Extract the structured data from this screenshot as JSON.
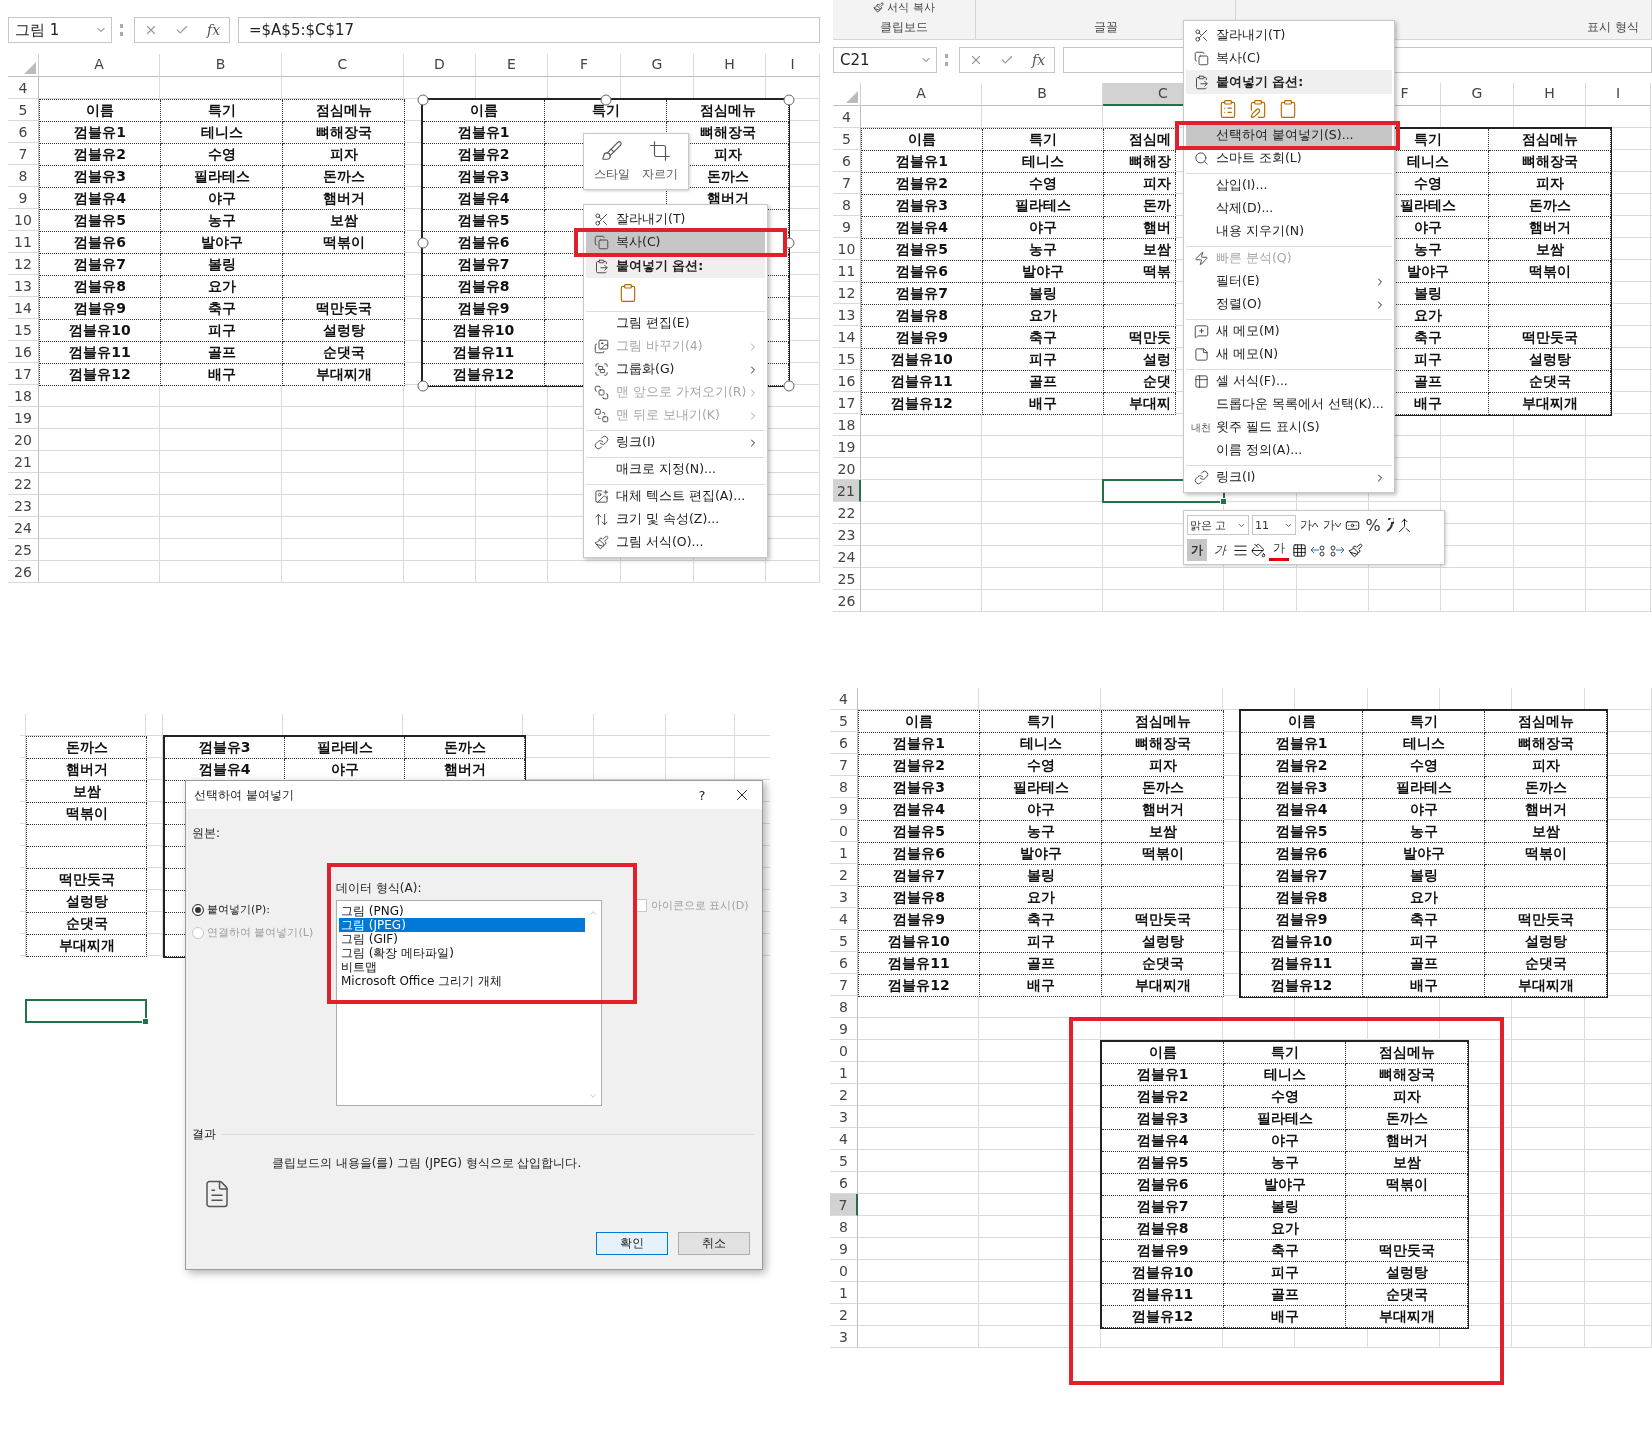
{
  "copy_step": {
    "name_box": "그림 1",
    "fx": "fx",
    "formula": "=$A$5:$C$17",
    "columns": [
      {
        "label": "A",
        "selected": false
      },
      {
        "label": "B",
        "selected": false
      },
      {
        "label": "C",
        "selected": false
      },
      {
        "label": "D",
        "selected": false
      },
      {
        "label": "E",
        "selected": false
      },
      {
        "label": "F",
        "selected": false
      },
      {
        "label": "G",
        "selected": false
      },
      {
        "label": "H",
        "selected": false
      },
      {
        "label": "I",
        "selected": false
      }
    ],
    "rows": [
      {
        "label": "4",
        "selected": false
      },
      {
        "label": "5",
        "selected": false
      },
      {
        "label": "6",
        "selected": false
      },
      {
        "label": "7",
        "selected": false
      },
      {
        "label": "8",
        "selected": false
      },
      {
        "label": "9",
        "selected": false
      },
      {
        "label": "10",
        "selected": false
      },
      {
        "label": "11",
        "selected": false
      },
      {
        "label": "12",
        "selected": false
      },
      {
        "label": "13",
        "selected": false
      },
      {
        "label": "14",
        "selected": false
      },
      {
        "label": "15",
        "selected": false
      },
      {
        "label": "16",
        "selected": false
      },
      {
        "label": "17",
        "selected": false
      },
      {
        "label": "18",
        "selected": false
      },
      {
        "label": "19",
        "selected": false
      },
      {
        "label": "20",
        "selected": false
      },
      {
        "label": "21",
        "selected": false
      },
      {
        "label": "22",
        "selected": false
      },
      {
        "label": "23",
        "selected": false
      },
      {
        "label": "24",
        "selected": false
      },
      {
        "label": "25",
        "selected": false
      },
      {
        "label": "26",
        "selected": false
      }
    ],
    "table": [
      {
        "col_1": "이름",
        "col_2": "특기",
        "col_3": "점심메뉴"
      },
      {
        "col_1": "껌블유1",
        "col_2": "테니스",
        "col_3": "뼈해장국"
      },
      {
        "col_1": "껌블유2",
        "col_2": "수영",
        "col_3": "피자"
      },
      {
        "col_1": "껌블유3",
        "col_2": "필라테스",
        "col_3": "돈까스"
      },
      {
        "col_1": "껌블유4",
        "col_2": "야구",
        "col_3": "햄버거"
      },
      {
        "col_1": "껌블유5",
        "col_2": "농구",
        "col_3": "보쌈"
      },
      {
        "col_1": "껌블유6",
        "col_2": "발야구",
        "col_3": "떡볶이"
      },
      {
        "col_1": "껌블유7",
        "col_2": "볼링"
      },
      {
        "col_1": "껌블유8",
        "col_2": "요가"
      },
      {
        "col_1": "껌블유9",
        "col_2": "축구",
        "col_3": "떡만둣국"
      },
      {
        "col_1": "껌블유10",
        "col_2": "피구",
        "col_3": "설렁탕"
      },
      {
        "col_1": "껌블유11",
        "col_2": "골프",
        "col_3": "순댓국"
      },
      {
        "col_1": "껌블유12",
        "col_2": "배구",
        "col_3": "부대찌개"
      }
    ],
    "picture_table": {
      "selected": true,
      "rows": [
        {
          "col_1": "이름",
          "col_2": "특기",
          "col_3": "점심메뉴"
        },
        {
          "col_1": "껌블유1",
          "col_3": "뼈해장국"
        },
        {
          "col_1": "껌블유2",
          "col_3": "피자"
        },
        {
          "col_1": "껌블유3",
          "col_3": "돈까스"
        },
        {
          "col_1": "껌블유4",
          "col_3": "햄버거"
        },
        {
          "col_1": "껌블유5"
        },
        {
          "col_1": "껌블유6"
        },
        {
          "col_1": "껌블유7"
        },
        {
          "col_1": "껌블유8"
        },
        {
          "col_1": "껌블유9"
        },
        {
          "col_1": "껌블유10"
        },
        {
          "col_1": "껌블유11"
        },
        {
          "col_1": "껌블유12"
        }
      ]
    },
    "mini_toolbar": [
      {
        "label": "스타일"
      },
      {
        "label": "자르기"
      }
    ],
    "menu": [
      {
        "kind": "item",
        "label": "잘라내기(T)",
        "highlighted": false,
        "disabled": false,
        "submenu": false,
        "separator_before": false
      },
      {
        "kind": "item",
        "label": "복사(C)",
        "highlighted": true,
        "disabled": false,
        "submenu": false,
        "separator_before": false
      },
      {
        "kind": "header",
        "label": "붙여넣기 옵션:",
        "highlighted": false,
        "disabled": false,
        "submenu": false,
        "separator_before": false
      },
      {
        "kind": "paste_icons",
        "highlighted": false,
        "disabled": false,
        "submenu": false,
        "separator_before": false
      },
      {
        "kind": "item",
        "label": "그림 편집(E)",
        "highlighted": false,
        "disabled": false,
        "submenu": false,
        "separator_before": true
      },
      {
        "kind": "item",
        "label": "그림 바꾸기(4)",
        "highlighted": false,
        "disabled": true,
        "submenu": true,
        "separator_before": false
      },
      {
        "kind": "item",
        "label": "그룹화(G)",
        "highlighted": false,
        "disabled": false,
        "submenu": true,
        "separator_before": false
      },
      {
        "kind": "item",
        "label": "맨 앞으로 가져오기(R)",
        "highlighted": false,
        "disabled": true,
        "submenu": true,
        "separator_before": false
      },
      {
        "kind": "item",
        "label": "맨 뒤로 보내기(K)",
        "highlighted": false,
        "disabled": true,
        "submenu": true,
        "separator_before": false
      },
      {
        "kind": "item",
        "label": "링크(I)",
        "highlighted": false,
        "disabled": false,
        "submenu": true,
        "separator_before": true
      },
      {
        "kind": "item",
        "label": "매크로 지정(N)...",
        "highlighted": false,
        "disabled": false,
        "submenu": false,
        "separator_before": true
      },
      {
        "kind": "item",
        "label": "대체 텍스트 편집(A)...",
        "highlighted": false,
        "disabled": false,
        "submenu": false,
        "separator_before": true
      },
      {
        "kind": "item",
        "label": "크기 및 속성(Z)...",
        "highlighted": false,
        "disabled": false,
        "submenu": false,
        "separator_before": false
      },
      {
        "kind": "item",
        "label": "그림 서식(O)...",
        "highlighted": false,
        "disabled": false,
        "submenu": false,
        "separator_before": false
      }
    ]
  },
  "paste_menu_step": {
    "ribbon": {
      "top_item": "서식 복사",
      "groups": [
        "클립보드",
        "글꼴",
        "표시 형식"
      ]
    },
    "name_box": "C21",
    "fx": "fx",
    "columns": [
      {
        "label": "A",
        "selected": false
      },
      {
        "label": "B",
        "selected": false
      },
      {
        "label": "C",
        "selected": true
      },
      {
        "label": "F",
        "selected": false
      },
      {
        "label": "G",
        "selected": false
      },
      {
        "label": "H",
        "selected": false
      },
      {
        "label": "I",
        "selected": false
      }
    ],
    "rows": [
      {
        "label": "4",
        "selected": false
      },
      {
        "label": "5",
        "selected": false
      },
      {
        "label": "6",
        "selected": false
      },
      {
        "label": "7",
        "selected": false
      },
      {
        "label": "8",
        "selected": false
      },
      {
        "label": "9",
        "selected": false
      },
      {
        "label": "10",
        "selected": false
      },
      {
        "label": "11",
        "selected": false
      },
      {
        "label": "12",
        "selected": false
      },
      {
        "label": "13",
        "selected": false
      },
      {
        "label": "14",
        "selected": false
      },
      {
        "label": "15",
        "selected": false
      },
      {
        "label": "16",
        "selected": false
      },
      {
        "label": "17",
        "selected": false
      },
      {
        "label": "18",
        "selected": false
      },
      {
        "label": "19",
        "selected": false
      },
      {
        "label": "20",
        "selected": false
      },
      {
        "label": "21",
        "selected": true
      },
      {
        "label": "22",
        "selected": false
      },
      {
        "label": "23",
        "selected": false
      },
      {
        "label": "24",
        "selected": false
      },
      {
        "label": "25",
        "selected": false
      },
      {
        "label": "26",
        "selected": false
      }
    ],
    "table": [
      {
        "col_1": "이름",
        "col_2": "특기",
        "col_3": "점심메"
      },
      {
        "col_1": "껌블유1",
        "col_2": "테니스",
        "col_3": "뼈해장"
      },
      {
        "col_1": "껌블유2",
        "col_2": "수영",
        "col_3": "피자"
      },
      {
        "col_1": "껌블유3",
        "col_2": "필라테스",
        "col_3": "돈까"
      },
      {
        "col_1": "껌블유4",
        "col_2": "야구",
        "col_3": "햄버"
      },
      {
        "col_1": "껌블유5",
        "col_2": "농구",
        "col_3": "보쌈"
      },
      {
        "col_1": "껌블유6",
        "col_2": "발야구",
        "col_3": "떡볶"
      },
      {
        "col_1": "껌블유7",
        "col_2": "볼링"
      },
      {
        "col_1": "껌블유8",
        "col_2": "요가"
      },
      {
        "col_1": "껌블유9",
        "col_2": "축구",
        "col_3": "떡만둣"
      },
      {
        "col_1": "껌블유10",
        "col_2": "피구",
        "col_3": "설렁"
      },
      {
        "col_1": "껌블유11",
        "col_2": "골프",
        "col_3": "순댓"
      },
      {
        "col_1": "껌블유12",
        "col_2": "배구",
        "col_3": "부대찌"
      }
    ],
    "picture_table": [
      {
        "col_2": "특기",
        "col_3": "점심메뉴"
      },
      {
        "col_2": "테니스",
        "col_3": "뼈해장국"
      },
      {
        "col_2": "수영",
        "col_3": "피자"
      },
      {
        "col_2": "필라테스",
        "col_3": "돈까스"
      },
      {
        "col_2": "야구",
        "col_3": "햄버거"
      },
      {
        "col_2": "농구",
        "col_3": "보쌈"
      },
      {
        "col_2": "발야구",
        "col_3": "떡볶이"
      },
      {
        "col_2": "볼링"
      },
      {
        "col_2": "요가"
      },
      {
        "col_2": "축구",
        "col_3": "떡만둣국"
      },
      {
        "col_2": "피구",
        "col_3": "설렁탕"
      },
      {
        "col_2": "골프",
        "col_3": "순댓국"
      },
      {
        "col_2": "배구",
        "col_3": "부대찌개"
      }
    ],
    "menu": [
      {
        "kind": "item",
        "label": "잘라내기(T)",
        "highlighted": false,
        "disabled": false,
        "submenu": false,
        "separator_before": false
      },
      {
        "kind": "item",
        "label": "복사(C)",
        "highlighted": false,
        "disabled": false,
        "submenu": false,
        "separator_before": false
      },
      {
        "kind": "header",
        "label": "붙여넣기 옵션:",
        "highlighted": false,
        "disabled": false,
        "submenu": false,
        "separator_before": false
      },
      {
        "kind": "paste_icons",
        "highlighted": false,
        "disabled": false,
        "submenu": false,
        "separator_before": false
      },
      {
        "kind": "item",
        "label": "선택하여 붙여넣기(S)...",
        "highlighted": true,
        "disabled": false,
        "submenu": false,
        "separator_before": false
      },
      {
        "kind": "item",
        "label": "스마트 조회(L)",
        "highlighted": false,
        "disabled": false,
        "submenu": false,
        "separator_before": false
      },
      {
        "kind": "item",
        "label": "삽입(I)...",
        "highlighted": false,
        "disabled": false,
        "submenu": false,
        "separator_before": true
      },
      {
        "kind": "item",
        "label": "삭제(D)...",
        "highlighted": false,
        "disabled": false,
        "submenu": false,
        "separator_before": false
      },
      {
        "kind": "item",
        "label": "내용 지우기(N)",
        "highlighted": false,
        "disabled": false,
        "submenu": false,
        "separator_before": false
      },
      {
        "kind": "item",
        "label": "빠른 분석(Q)",
        "highlighted": false,
        "disabled": true,
        "submenu": false,
        "separator_before": true
      },
      {
        "kind": "item",
        "label": "필터(E)",
        "highlighted": false,
        "disabled": false,
        "submenu": true,
        "separator_before": false
      },
      {
        "kind": "item",
        "label": "정렬(O)",
        "highlighted": false,
        "disabled": false,
        "submenu": true,
        "separator_before": false
      },
      {
        "kind": "item",
        "label": "새 메모(M)",
        "highlighted": false,
        "disabled": false,
        "submenu": false,
        "separator_before": true
      },
      {
        "kind": "item",
        "label": "새 메모(N)",
        "highlighted": false,
        "disabled": false,
        "submenu": false,
        "separator_before": false
      },
      {
        "kind": "item",
        "label": "셀 서식(F)...",
        "highlighted": false,
        "disabled": false,
        "submenu": false,
        "separator_before": true
      },
      {
        "kind": "item",
        "label": "드롭다운 목록에서 선택(K)...",
        "highlighted": false,
        "disabled": false,
        "submenu": false,
        "separator_before": false
      },
      {
        "kind": "item",
        "label": "윗주 필드 표시(S)",
        "icon_text": "내천",
        "highlighted": false,
        "disabled": false,
        "submenu": false,
        "separator_before": false
      },
      {
        "kind": "item",
        "label": "이름 정의(A)...",
        "highlighted": false,
        "disabled": false,
        "submenu": false,
        "separator_before": false
      },
      {
        "kind": "item",
        "label": "링크(I)",
        "highlighted": false,
        "disabled": false,
        "submenu": true,
        "separator_before": true
      }
    ],
    "format_toolbar": {
      "font": "맑은 고",
      "size": "11",
      "top_buttons": [
        {
          "kind": "grow",
          "label": "가"
        },
        {
          "kind": "shrink",
          "label": "가"
        },
        {
          "kind": "percent",
          "label": "%"
        }
      ],
      "bottom_buttons": [
        {
          "kind": "bold",
          "label": "가",
          "selected": true
        },
        {
          "kind": "italic",
          "label": "가",
          "selected": false
        },
        {
          "kind": "font_color",
          "label": "가",
          "selected": false
        }
      ]
    }
  },
  "dialog_step": {
    "left_column_blocks": [
      [
        "돈까스",
        "햄버거",
        "보쌈",
        "떡볶이"
      ],
      [
        "떡만둣국",
        "설렁탕",
        "순댓국",
        "부대찌개"
      ]
    ],
    "picture_table": [
      {
        "col_1": "껌블유3",
        "col_2": "필라테스",
        "col_3": "돈까스"
      },
      {
        "col_1": "껌블유4",
        "col_2": "야구",
        "col_3": "햄버거"
      }
    ],
    "active_cell": true,
    "dialog": {
      "title": "선택하여 붙여넣기",
      "help": "?",
      "source_label": "원본:",
      "paste_modes": [
        {
          "label": "붙여넣기(P):",
          "selected": true,
          "disabled": false
        },
        {
          "label": "연결하여 붙여넣기(L)",
          "selected": false,
          "disabled": true
        }
      ],
      "format_label": "데이터 형식(A):",
      "formats": [
        {
          "label": "그림 (PNG)",
          "selected": false
        },
        {
          "label": "그림 (JPEG)",
          "selected": true
        },
        {
          "label": "그림 (GIF)",
          "selected": false
        },
        {
          "label": "그림 (확장 메타파일)",
          "selected": false
        },
        {
          "label": "비트맵",
          "selected": false
        },
        {
          "label": "Microsoft Office 그리기 개체",
          "selected": false
        }
      ],
      "icon_option": {
        "label": "아이콘으로 표시(D)",
        "checked": false,
        "disabled": true
      },
      "result_label": "결과",
      "result_text": "클립보드의 내용을(를) 그림 (JPEG) 형식으로 삽입합니다.",
      "buttons": [
        {
          "label": "확인",
          "kind": "default"
        },
        {
          "label": "취소",
          "kind": "normal"
        }
      ]
    }
  },
  "result_step": {
    "rows": [
      {
        "label": "4",
        "selected": false
      },
      {
        "label": "5",
        "selected": false
      },
      {
        "label": "6",
        "selected": false
      },
      {
        "label": "7",
        "selected": false
      },
      {
        "label": "8",
        "selected": false
      },
      {
        "label": "9",
        "selected": false
      },
      {
        "label": "0",
        "selected": false
      },
      {
        "label": "1",
        "selected": false
      },
      {
        "label": "2",
        "selected": false
      },
      {
        "label": "3",
        "selected": false
      },
      {
        "label": "4",
        "selected": false
      },
      {
        "label": "5",
        "selected": false
      },
      {
        "label": "6",
        "selected": false
      },
      {
        "label": "7",
        "selected": false
      },
      {
        "label": "8",
        "selected": false
      },
      {
        "label": "9",
        "selected": false
      },
      {
        "label": "0",
        "selected": false
      },
      {
        "label": "1",
        "selected": false
      },
      {
        "label": "2",
        "selected": false
      },
      {
        "label": "3",
        "selected": false
      },
      {
        "label": "4",
        "selected": false
      },
      {
        "label": "5",
        "selected": false
      },
      {
        "label": "6",
        "selected": false
      },
      {
        "label": "7",
        "selected": true
      },
      {
        "label": "8",
        "selected": false
      },
      {
        "label": "9",
        "selected": false
      },
      {
        "label": "0",
        "selected": false
      },
      {
        "label": "1",
        "selected": false
      },
      {
        "label": "2",
        "selected": false
      },
      {
        "label": "3",
        "selected": false
      }
    ],
    "source_table": [
      {
        "col_1": "이름",
        "col_2": "특기",
        "col_3": "점심메뉴"
      },
      {
        "col_1": "껌블유1",
        "col_2": "테니스",
        "col_3": "뼈해장국"
      },
      {
        "col_1": "껌블유2",
        "col_2": "수영",
        "col_3": "피자"
      },
      {
        "col_1": "껌블유3",
        "col_2": "필라테스",
        "col_3": "돈까스"
      },
      {
        "col_1": "껌블유4",
        "col_2": "야구",
        "col_3": "햄버거"
      },
      {
        "col_1": "껌블유5",
        "col_2": "농구",
        "col_3": "보쌈"
      },
      {
        "col_1": "껌블유6",
        "col_2": "발야구",
        "col_3": "떡볶이"
      },
      {
        "col_1": "껌블유7",
        "col_2": "볼링"
      },
      {
        "col_1": "껌블유8",
        "col_2": "요가"
      },
      {
        "col_1": "껌블유9",
        "col_2": "축구",
        "col_3": "떡만둣국"
      },
      {
        "col_1": "껌블유10",
        "col_2": "피구",
        "col_3": "설렁탕"
      },
      {
        "col_1": "껌블유11",
        "col_2": "골프",
        "col_3": "순댓국"
      },
      {
        "col_1": "껌블유12",
        "col_2": "배구",
        "col_3": "부대찌개"
      }
    ],
    "picture_table": [
      {
        "col_1": "이름",
        "col_2": "특기",
        "col_3": "점심메뉴"
      },
      {
        "col_1": "껌블유1",
        "col_2": "테니스",
        "col_3": "뼈해장국"
      },
      {
        "col_1": "껌블유2",
        "col_2": "수영",
        "col_3": "피자"
      },
      {
        "col_1": "껌블유3",
        "col_2": "필라테스",
        "col_3": "돈까스"
      },
      {
        "col_1": "껌블유4",
        "col_2": "야구",
        "col_3": "햄버거"
      },
      {
        "col_1": "껌블유5",
        "col_2": "농구",
        "col_3": "보쌈"
      },
      {
        "col_1": "껌블유6",
        "col_2": "발야구",
        "col_3": "떡볶이"
      },
      {
        "col_1": "껌블유7",
        "col_2": "볼링"
      },
      {
        "col_1": "껌블유8",
        "col_2": "요가"
      },
      {
        "col_1": "껌블유9",
        "col_2": "축구",
        "col_3": "떡만둣국"
      },
      {
        "col_1": "껌블유10",
        "col_2": "피구",
        "col_3": "설렁탕"
      },
      {
        "col_1": "껌블유11",
        "col_2": "골프",
        "col_3": "순댓국"
      },
      {
        "col_1": "껌블유12",
        "col_2": "배구",
        "col_3": "부대찌개"
      }
    ],
    "pasted_table": [
      {
        "col_1": "이름",
        "col_2": "특기",
        "col_3": "점심메뉴"
      },
      {
        "col_1": "껌블유1",
        "col_2": "테니스",
        "col_3": "뼈해장국"
      },
      {
        "col_1": "껌블유2",
        "col_2": "수영",
        "col_3": "피자"
      },
      {
        "col_1": "껌블유3",
        "col_2": "필라테스",
        "col_3": "돈까스"
      },
      {
        "col_1": "껌블유4",
        "col_2": "야구",
        "col_3": "햄버거"
      },
      {
        "col_1": "껌블유5",
        "col_2": "농구",
        "col_3": "보쌈"
      },
      {
        "col_1": "껌블유6",
        "col_2": "발야구",
        "col_3": "떡볶이"
      },
      {
        "col_1": "껌블유7",
        "col_2": "볼링"
      },
      {
        "col_1": "껌블유8",
        "col_2": "요가"
      },
      {
        "col_1": "껌블유9",
        "col_2": "축구",
        "col_3": "떡만둣국"
      },
      {
        "col_1": "껌블유10",
        "col_2": "피구",
        "col_3": "설렁탕"
      },
      {
        "col_1": "껌블유11",
        "col_2": "골프",
        "col_3": "순댓국"
      },
      {
        "col_1": "껌블유12",
        "col_2": "배구",
        "col_3": "부대찌개"
      }
    ]
  }
}
